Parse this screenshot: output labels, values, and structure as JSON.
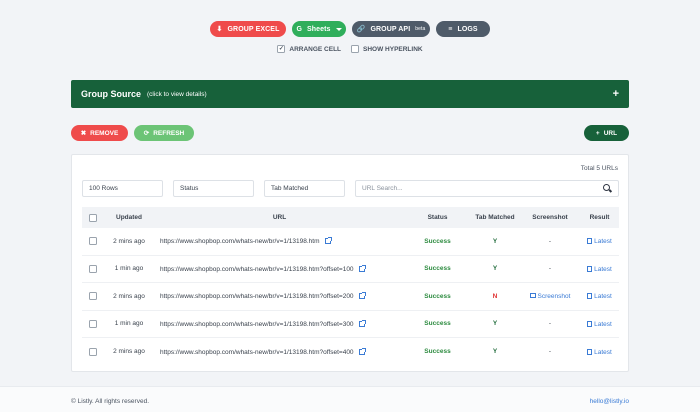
{
  "toolbar": {
    "group_excel": "GROUP EXCEL",
    "sheets": "Sheets",
    "group_api": "GROUP API",
    "group_api_sup": "beta",
    "logs": "LOGS"
  },
  "options": {
    "arrange_cell": "ARRANGE CELL",
    "arrange_checked": "✓",
    "show_hyperlink": "SHOW HYPERLINK"
  },
  "source": {
    "title": "Group Source",
    "hint": "(click to view details)",
    "expand": "+"
  },
  "actions": {
    "remove": "REMOVE",
    "refresh": "REFRESH",
    "add_url": "URL"
  },
  "panel": {
    "total": "Total  5 URLs",
    "rows_filter": "100 Rows",
    "status_filter": "Status",
    "tab_filter": "Tab Matched",
    "search_placeholder": "URL Search..."
  },
  "table": {
    "headers": [
      "Updated",
      "URL",
      "Status",
      "Tab Matched",
      "Screenshot",
      "Result"
    ],
    "rows": [
      {
        "updated": "2 mins ago",
        "url": "https://www.shopbop.com/whats-new/br/v=1/13198.htm",
        "status": "Success",
        "tab": "Y",
        "shot": "-",
        "result": "Latest"
      },
      {
        "updated": "1 min ago",
        "url": "https://www.shopbop.com/whats-new/br/v=1/13198.htm?offset=100",
        "status": "Success",
        "tab": "Y",
        "shot": "-",
        "result": "Latest"
      },
      {
        "updated": "2 mins ago",
        "url": "https://www.shopbop.com/whats-new/br/v=1/13198.htm?offset=200",
        "status": "Success",
        "tab": "N",
        "shot": "Screenshot",
        "result": "Latest"
      },
      {
        "updated": "1 min ago",
        "url": "https://www.shopbop.com/whats-new/br/v=1/13198.htm?offset=300",
        "status": "Success",
        "tab": "Y",
        "shot": "-",
        "result": "Latest"
      },
      {
        "updated": "2 mins ago",
        "url": "https://www.shopbop.com/whats-new/br/v=1/13198.htm?offset=400",
        "status": "Success",
        "tab": "Y",
        "shot": "-",
        "result": "Latest"
      }
    ]
  },
  "footer": {
    "copyright": "© Listly. All rights reserved.",
    "email": "hello@listly.io"
  },
  "colors": {
    "red": "#ef4b4b",
    "green": "#2fae5b",
    "dark_green": "#17613a",
    "slate": "#4f5b69",
    "link": "#3a7bd5"
  }
}
